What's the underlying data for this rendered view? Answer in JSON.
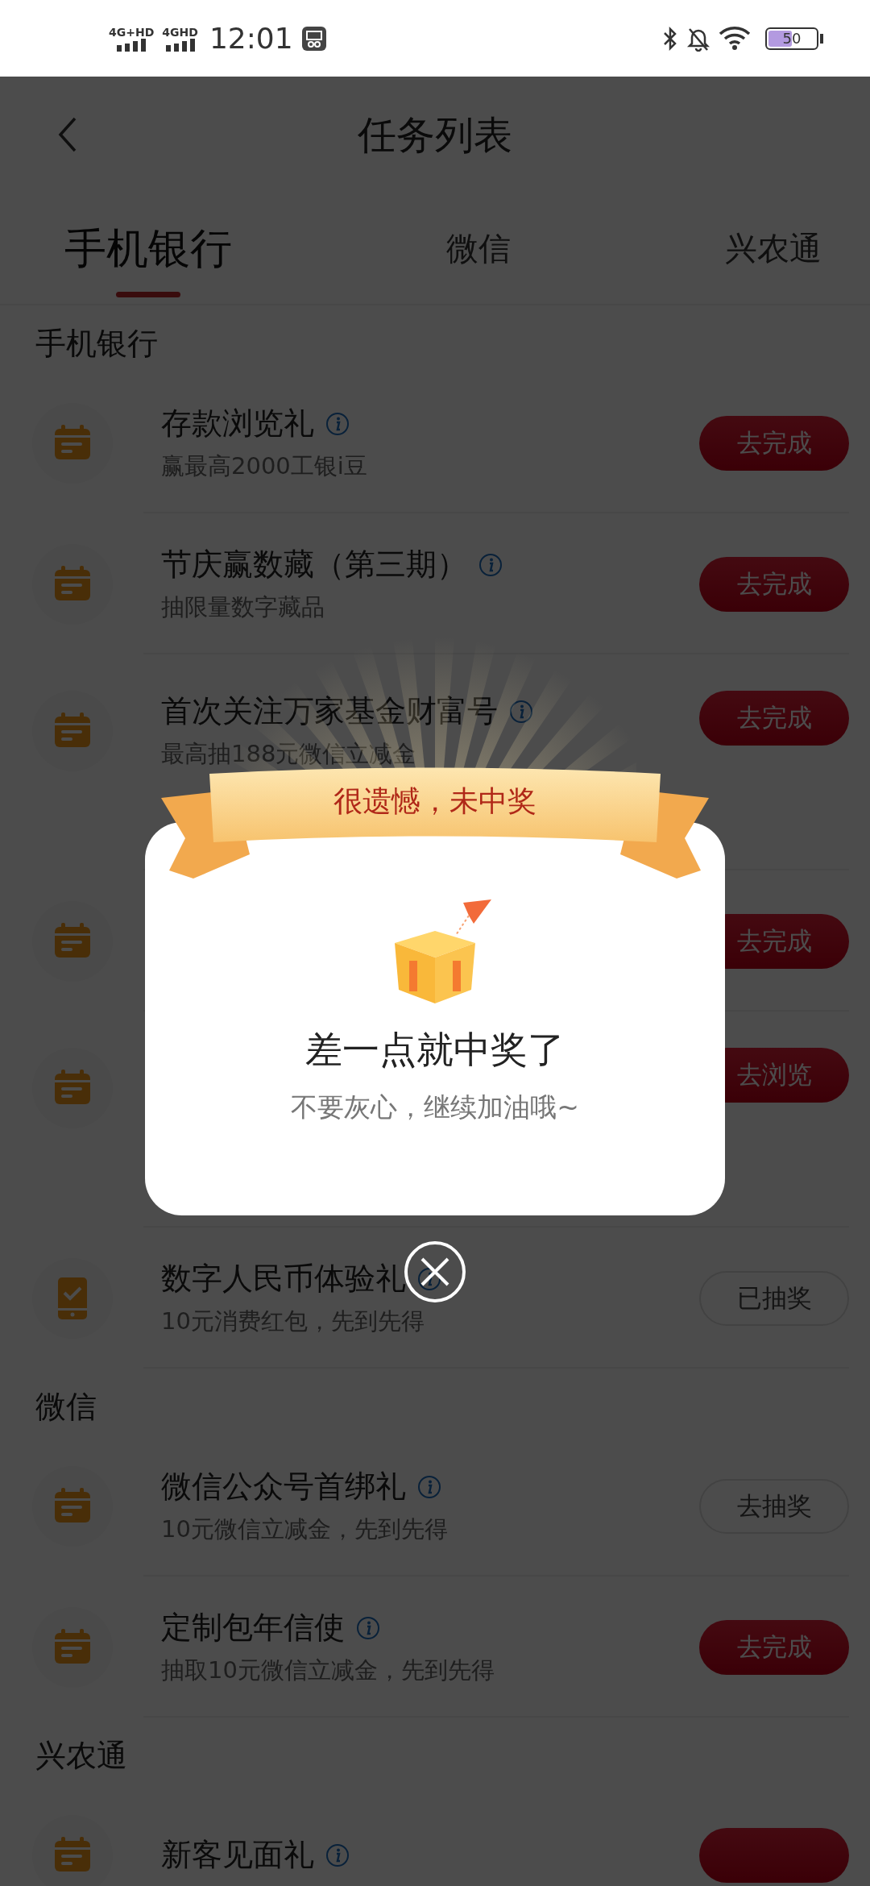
{
  "status_bar": {
    "signal_1": "4G+HD",
    "signal_2": "4GHD",
    "time": "12:01",
    "battery": "50"
  },
  "header": {
    "title": "任务列表"
  },
  "tabs": [
    {
      "label": "手机银行",
      "selected": true
    },
    {
      "label": "微信",
      "selected": false
    },
    {
      "label": "兴农通",
      "selected": false
    }
  ],
  "sections": [
    {
      "title": "手机银行",
      "tasks": [
        {
          "kind": "calendar",
          "title": "存款浏览礼",
          "subtitle": "赢最高2000工银i豆",
          "button": {
            "label": "去完成",
            "kind": "filled"
          }
        },
        {
          "kind": "calendar",
          "title": "节庆赢数藏（第三期）",
          "subtitle": "抽限量数字藏品",
          "button": {
            "label": "去完成",
            "kind": "filled"
          }
        },
        {
          "kind": "calendar",
          "title": "首次关注万家基金财富号",
          "subtitle": "最高抽188元微信立减金",
          "button": {
            "label": "去完成",
            "kind": "filled"
          }
        },
        {
          "kind": "calendar",
          "button": {
            "label": "去完成",
            "kind": "filled"
          }
        },
        {
          "kind": "calendar",
          "button": {
            "label": "去浏览",
            "kind": "filled"
          }
        },
        {
          "kind": "phone",
          "title": "数字人民币体验礼",
          "subtitle": "10元消费红包，先到先得",
          "button": {
            "label": "已抽奖",
            "kind": "outline"
          }
        }
      ]
    },
    {
      "title": "微信",
      "tasks": [
        {
          "kind": "calendar",
          "title": "微信公众号首绑礼",
          "subtitle": "10元微信立减金，先到先得",
          "button": {
            "label": "去抽奖",
            "kind": "outline"
          }
        },
        {
          "kind": "calendar",
          "title": "定制包年信使",
          "subtitle": "抽取10元微信立减金，先到先得",
          "button": {
            "label": "去完成",
            "kind": "filled"
          }
        }
      ]
    },
    {
      "title": "兴农通",
      "tasks": [
        {
          "kind": "calendar",
          "title": "新客见面礼",
          "button": {
            "kind": "filled"
          }
        }
      ]
    }
  ],
  "dialog": {
    "ribbon": "很遗憾，未中奖",
    "title": "差一点就中奖了",
    "message": "不要灰心，继续加油哦~"
  }
}
